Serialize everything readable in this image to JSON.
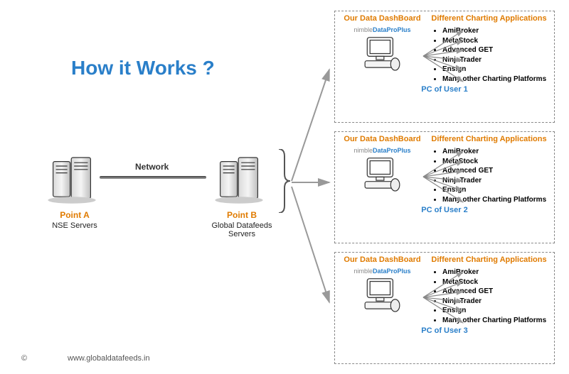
{
  "title": "How it Works ?",
  "network_label": "Network",
  "point_a": {
    "label": "Point A",
    "sub": "NSE Servers"
  },
  "point_b": {
    "label": "Point B",
    "sub": "Global Datafeeds Servers"
  },
  "user_box": {
    "header_left": "Our Data DashBoard",
    "header_right": "Different Charting Applications",
    "product_prefix": "nimble",
    "product_name": "DataProPlus",
    "apps": [
      "AmiBroker",
      "MetaStock",
      "Advanced GET",
      "NinjaTrader",
      "Ensign",
      "Many other Charting Platforms"
    ]
  },
  "users": [
    {
      "footer": "PC of User 1"
    },
    {
      "footer": "PC of User 2"
    },
    {
      "footer": "PC of User 3"
    }
  ],
  "copyright_symbol": "©",
  "url": "www.globaldatafeeds.in"
}
